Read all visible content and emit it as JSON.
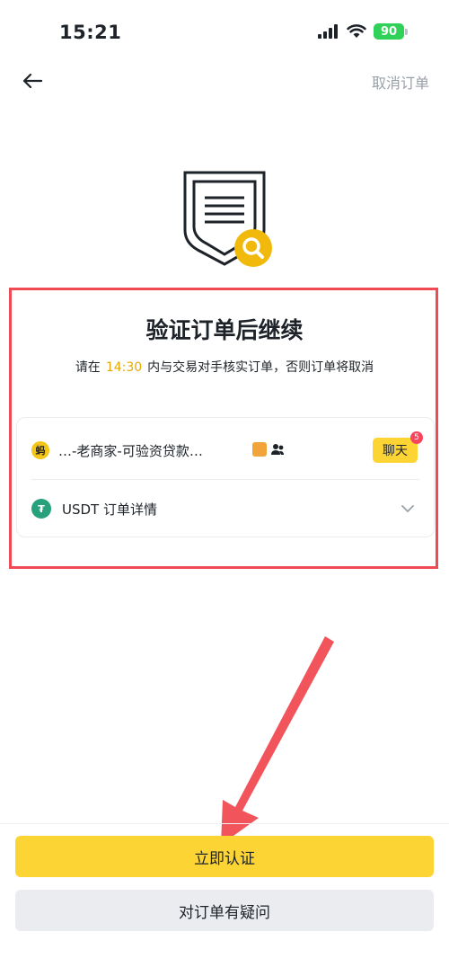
{
  "status_bar": {
    "time": "15:21",
    "battery": "90"
  },
  "nav": {
    "cancel_label": "取消订单"
  },
  "main": {
    "title": "验证订单后继续",
    "subtitle_before": "请在",
    "timer": "14:30",
    "subtitle_after": "内与交易对手核实订单，否则订单将取消"
  },
  "card": {
    "merchant_avatar": "蚂",
    "merchant_name": "…-老商家-可验资贷款…",
    "chat_label": "聊天",
    "chat_unread": "5",
    "usdt_icon": "₮",
    "usdt_label": "USDT 订单详情"
  },
  "actions": {
    "primary_label": "立即认证",
    "secondary_label": "对订单有疑问"
  },
  "colors": {
    "accent": "#fcd535",
    "timer": "#e5a700",
    "highlight": "#ef4b55",
    "badge": "#f6465d",
    "usdt": "#26a17b"
  },
  "icons": {
    "back": "arrow-left-icon",
    "hero": "shield-document-search-icon",
    "chevron": "chevron-down-icon",
    "pointer": "red-arrow-annotation"
  }
}
